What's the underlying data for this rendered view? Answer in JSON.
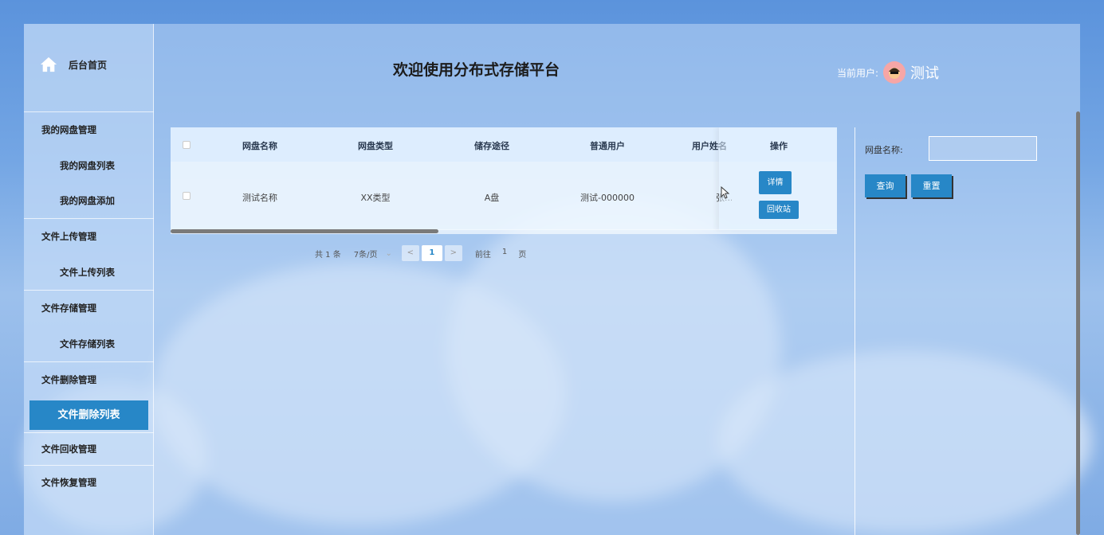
{
  "sidebar": {
    "home_label": "后台首页",
    "groups": [
      {
        "label": "我的网盘管理",
        "items": [
          "我的网盘列表",
          "我的网盘添加"
        ]
      },
      {
        "label": "文件上传管理",
        "items": [
          "文件上传列表"
        ]
      },
      {
        "label": "文件存储管理",
        "items": [
          "文件存储列表"
        ]
      },
      {
        "label": "文件删除管理",
        "items": [
          "文件删除列表"
        ]
      },
      {
        "label": "文件回收管理",
        "items": []
      },
      {
        "label": "文件恢复管理",
        "items": []
      }
    ],
    "active_item": "文件删除列表"
  },
  "header": {
    "title": "欢迎使用分布式存储平台",
    "user_label": "当前用户:",
    "user_name": "测试"
  },
  "table": {
    "columns": [
      "网盘名称",
      "网盘类型",
      "储存途径",
      "普通用户",
      "用户姓名",
      "操作"
    ],
    "rows": [
      {
        "name": "测试名称",
        "type": "XX类型",
        "path": "A盘",
        "user": "测试-000000",
        "user_name": "张..."
      }
    ],
    "actions": {
      "detail": "详情",
      "recycle": "回收站"
    }
  },
  "pagination": {
    "total": "共 1 条",
    "page_size": "7条/页",
    "prev": "<",
    "current_page": "1",
    "next": ">",
    "goto_label": "前往",
    "goto_value": "1",
    "goto_unit": "页"
  },
  "search": {
    "label": "网盘名称:",
    "value": "",
    "query_button": "查询",
    "reset_button": "重置"
  },
  "colors": {
    "accent": "#2787c7",
    "background_sky": "#74a6e4"
  }
}
